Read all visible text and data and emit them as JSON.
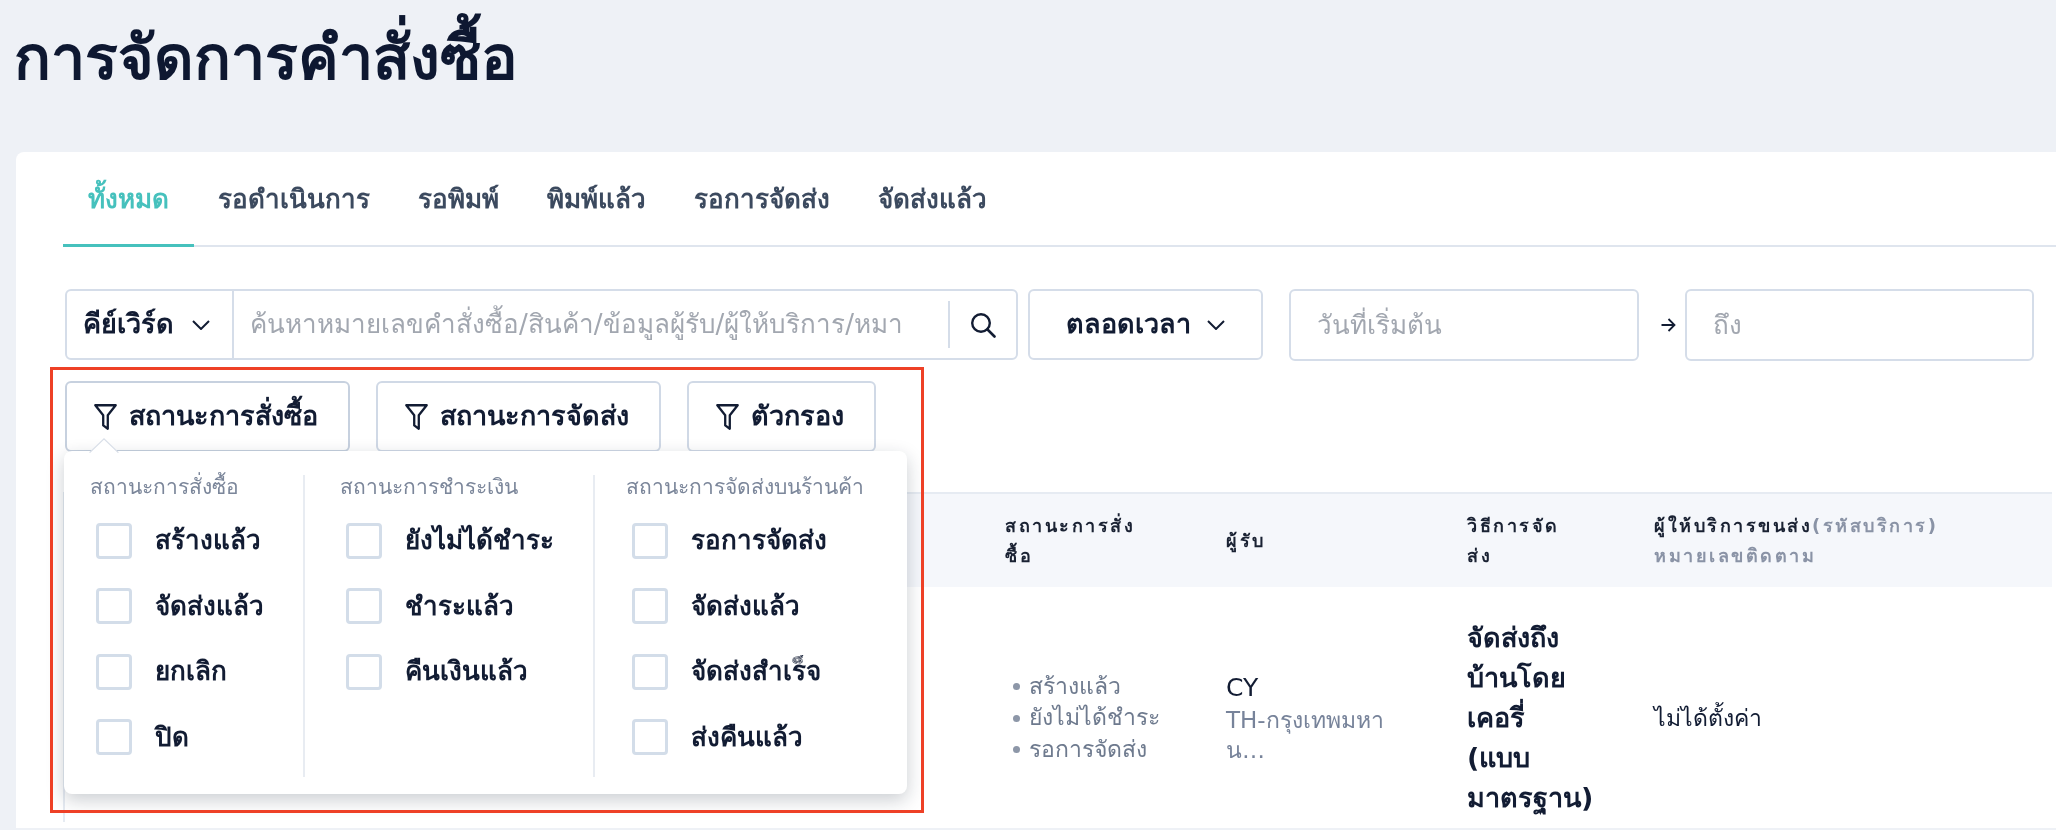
{
  "page": {
    "title": "การจัดการคำสั่งซื้อ"
  },
  "tabs": [
    {
      "label": "ทั้งหมด",
      "selected": true
    },
    {
      "label": "รอดำเนินการ",
      "selected": false
    },
    {
      "label": "รอพิมพ์",
      "selected": false
    },
    {
      "label": "พิมพ์แล้ว",
      "selected": false
    },
    {
      "label": "รอการจัดส่ง",
      "selected": false
    },
    {
      "label": "จัดส่งแล้ว",
      "selected": false
    }
  ],
  "search": {
    "field_type": "คีย์เวิร์ด",
    "placeholder": "ค้นหาหมายเลขคำสั่งซื้อ/สินค้า/ข้อมูลผู้รับ/ผู้ให้บริการ/หมา"
  },
  "date_range": {
    "period": "ตลอดเวลา",
    "start_placeholder": "วันที่เริ่มต้น",
    "end_placeholder": "ถึง"
  },
  "filter_buttons": [
    {
      "label": "สถานะการสั่งซื้อ",
      "expanded": true
    },
    {
      "label": "สถานะการจัดส่ง",
      "expanded": false
    },
    {
      "label": "ตัวกรอง",
      "expanded": false
    }
  ],
  "filter_dropdown": {
    "groups": [
      {
        "title": "สถานะการสั่งซื้อ",
        "options": [
          {
            "label": "สร้างแล้ว",
            "checked": false
          },
          {
            "label": "จัดส่งแล้ว",
            "checked": false
          },
          {
            "label": "ยกเลิก",
            "checked": false
          },
          {
            "label": "ปิด",
            "checked": false
          }
        ]
      },
      {
        "title": "สถานะการชำระเงิน",
        "options": [
          {
            "label": "ยังไม่ได้ชำระ",
            "checked": false
          },
          {
            "label": "ชำระแล้ว",
            "checked": false
          },
          {
            "label": "คืนเงินแล้ว",
            "checked": false
          }
        ]
      },
      {
        "title": "สถานะการจัดส่งบนร้านค้า",
        "options": [
          {
            "label": "รอการจัดส่ง",
            "checked": false
          },
          {
            "label": "จัดส่งแล้ว",
            "checked": false
          },
          {
            "label": "จัดส่งสำเร็จ",
            "checked": false
          },
          {
            "label": "ส่งคืนแล้ว",
            "checked": false
          }
        ]
      }
    ]
  },
  "table": {
    "columns": [
      {
        "label": "สถานะการสั่งซื้อ"
      },
      {
        "label": "ผู้รับ"
      },
      {
        "label": "วิธีการจัดส่ง"
      },
      {
        "label": "ผู้ให้บริการขนส่ง",
        "note": "(รหัสบริการ)",
        "sublabel": "หมายเลขติดตาม"
      }
    ],
    "rows": [
      {
        "order_statuses": [
          "สร้างแล้ว",
          "ยังไม่ได้ชำระ",
          "รอการจัดส่ง"
        ],
        "recipient_name": "CY",
        "recipient_region": "TH-กรุงเทพมหาน…",
        "shipping_method": "จัดส่งถึงบ้านโดยเคอรี่ (แบบมาตรฐาน)",
        "carrier": "ไม่ได้ตั้งค่า"
      }
    ]
  }
}
